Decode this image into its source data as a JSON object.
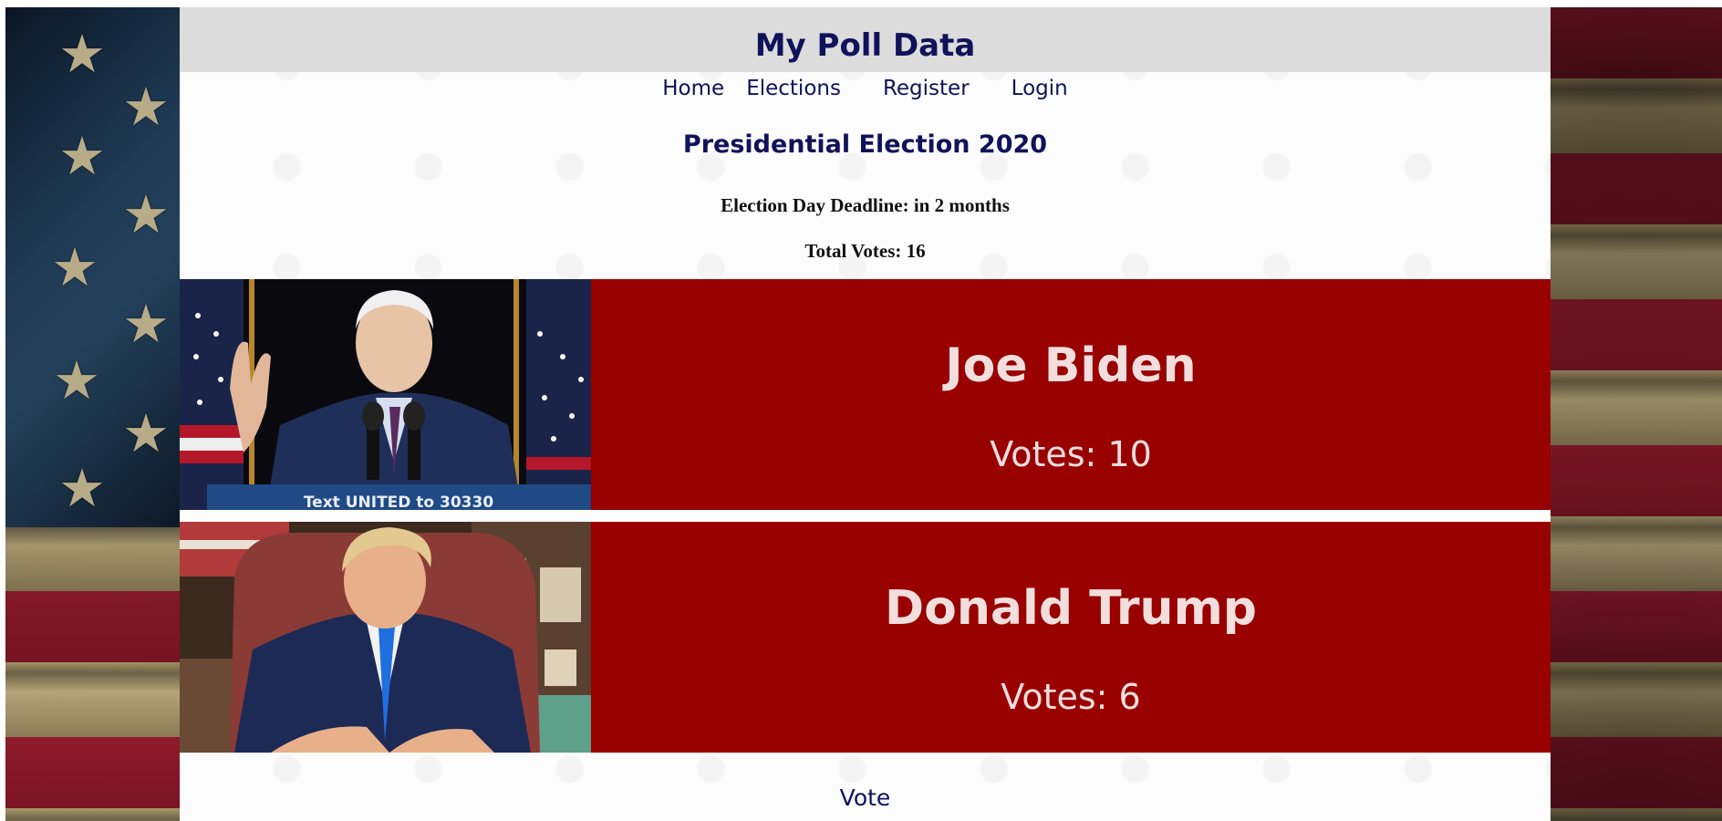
{
  "site": {
    "title": "My Poll Data"
  },
  "nav": {
    "home": "Home",
    "elections": "Elections",
    "register": "Register",
    "login": "Login"
  },
  "election": {
    "title": "Presidential Election 2020",
    "deadline": "Election Day Deadline: in 2 months",
    "total_votes": "Total Votes: 16"
  },
  "candidates": [
    {
      "name": "Joe Biden",
      "votes": "Votes: 10",
      "photo_caption": "Text UNITED to 30330"
    },
    {
      "name": "Donald Trump",
      "votes": "Votes: 6"
    }
  ],
  "actions": {
    "vote": "Vote"
  },
  "colors": {
    "candidate_panel": "#990000",
    "heading": "#10135a",
    "candidate_text": "#f3dede"
  }
}
